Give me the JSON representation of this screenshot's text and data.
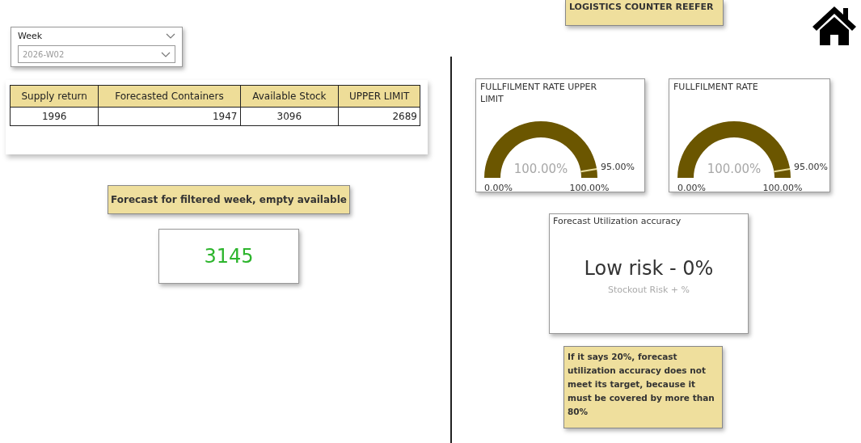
{
  "slicer": {
    "label": "Week",
    "value": "2026-W02"
  },
  "table": {
    "columns": [
      "Supply return",
      "Forecasted Containers",
      "Available Stock",
      "UPPER LIMIT"
    ],
    "rows": [
      [
        "1996",
        "1947",
        "3096",
        "2689"
      ]
    ]
  },
  "forecast_label": "Forecast for filtered week, empty available",
  "forecast_value": "3145",
  "title": "LOGISTICS COUNTER REEFER",
  "gauges": [
    {
      "title": "FULLFILMENT RATE UPPER LIMIT",
      "value": "100.00%",
      "min": "0.00%",
      "max": "100.00%",
      "target": "95.00%"
    },
    {
      "title": "FULLFILMENT RATE",
      "value": "100.00%",
      "min": "0.00%",
      "max": "100.00%",
      "target": "95.00%"
    }
  ],
  "accuracy": {
    "title": "Forecast Utilization accuracy",
    "value": "Low risk - 0%",
    "caption": "Stockout Risk + %"
  },
  "note": "If it says 20%, forecast utilization accuracy does not meet its target, because it must be covered by more than 80%"
}
